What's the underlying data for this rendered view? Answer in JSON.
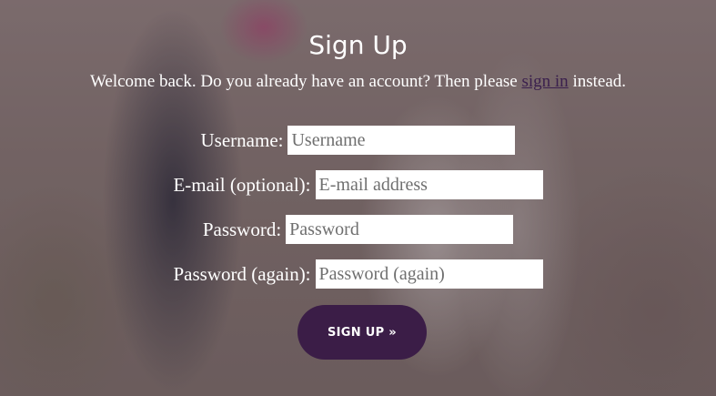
{
  "page": {
    "title": "Sign Up",
    "welcome_prefix": "Welcome back. Do you already have an account? Then please ",
    "signin_link": "sign in",
    "welcome_suffix": " instead."
  },
  "form": {
    "username": {
      "label": "Username:",
      "placeholder": "Username",
      "value": ""
    },
    "email": {
      "label": "E-mail (optional):",
      "placeholder": "E-mail address",
      "value": ""
    },
    "password": {
      "label": "Password:",
      "placeholder": "Password",
      "value": ""
    },
    "password2": {
      "label": "Password (again):",
      "placeholder": "Password (again)",
      "value": ""
    },
    "submit_label": "SIGN UP »"
  },
  "colors": {
    "button_bg": "#3b1d47",
    "link": "#3a1f4d",
    "text": "#ffffff"
  }
}
